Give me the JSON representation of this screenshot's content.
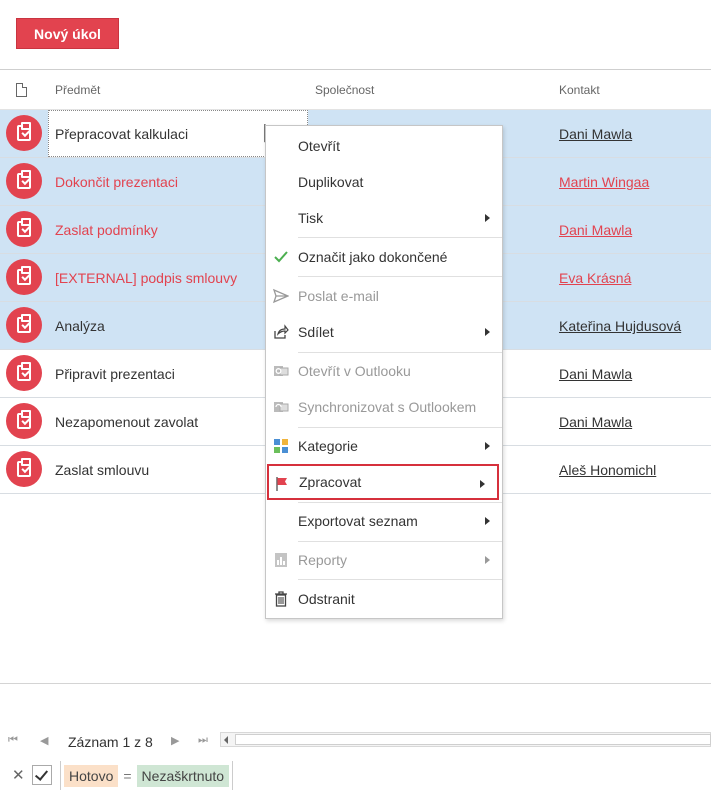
{
  "toolbar": {
    "new_task": "Nový úkol"
  },
  "grid": {
    "columns": {
      "subject": "Předmět",
      "company": "Společnost",
      "contact": "Kontakt"
    },
    "rows": [
      {
        "subject": "Přepracovat kalkulaci",
        "contact": "Dani Mawla",
        "selected": true,
        "overdue": false
      },
      {
        "subject": "Dokončit prezentaci",
        "contact": "Martin Wingaa",
        "selected": true,
        "overdue": true
      },
      {
        "subject": "Zaslat podmínky",
        "contact": "Dani Mawla",
        "selected": true,
        "overdue": true
      },
      {
        "subject": "[EXTERNAL] podpis smlouvy",
        "contact": "Eva Krásná",
        "selected": true,
        "overdue": true
      },
      {
        "subject": "Analýza",
        "contact": "Kateřina Hujdusová",
        "selected": true,
        "overdue": false
      },
      {
        "subject": "Připravit prezentaci",
        "contact": "Dani Mawla",
        "selected": false,
        "overdue": false
      },
      {
        "subject": "Nezapomenout zavolat",
        "contact": "Dani Mawla",
        "selected": false,
        "overdue": false
      },
      {
        "subject": "Zaslat smlouvu",
        "contact": "Aleš Honomichl",
        "selected": false,
        "overdue": false
      }
    ]
  },
  "context_menu": {
    "items": [
      {
        "label": "Otevřít",
        "icon": "",
        "submenu": false,
        "disabled": false
      },
      {
        "label": "Duplikovat",
        "icon": "",
        "submenu": false,
        "disabled": false
      },
      {
        "label": "Tisk",
        "icon": "",
        "submenu": true,
        "disabled": false
      },
      {
        "label": "Označit jako dokončené",
        "icon": "check-icon",
        "submenu": false,
        "disabled": false
      },
      {
        "label": "Poslat e-mail",
        "icon": "send-icon",
        "submenu": false,
        "disabled": true
      },
      {
        "label": "Sdílet",
        "icon": "share-icon",
        "submenu": true,
        "disabled": false
      },
      {
        "label": "Otevřít v Outlooku",
        "icon": "outlook-icon",
        "submenu": false,
        "disabled": true
      },
      {
        "label": "Synchronizovat s Outlookem",
        "icon": "outlook-sync-icon",
        "submenu": false,
        "disabled": true
      },
      {
        "label": "Kategorie",
        "icon": "categories-icon",
        "submenu": true,
        "disabled": false
      },
      {
        "label": "Zpracovat",
        "icon": "flag-icon",
        "submenu": true,
        "disabled": false,
        "highlighted": true
      },
      {
        "label": "Exportovat seznam",
        "icon": "",
        "submenu": true,
        "disabled": false
      },
      {
        "label": "Reporty",
        "icon": "report-icon",
        "submenu": true,
        "disabled": true
      },
      {
        "label": "Odstranit",
        "icon": "trash-icon",
        "submenu": false,
        "disabled": false
      }
    ]
  },
  "pager": {
    "record_text": "Záznam 1 z 8"
  },
  "filter": {
    "field": "Hotovo",
    "operator": "=",
    "value": "Nezaškrtnuto"
  },
  "colors": {
    "accent": "#e2434f",
    "selection": "#cfe3f4",
    "highlight_border": "#d6303c"
  }
}
